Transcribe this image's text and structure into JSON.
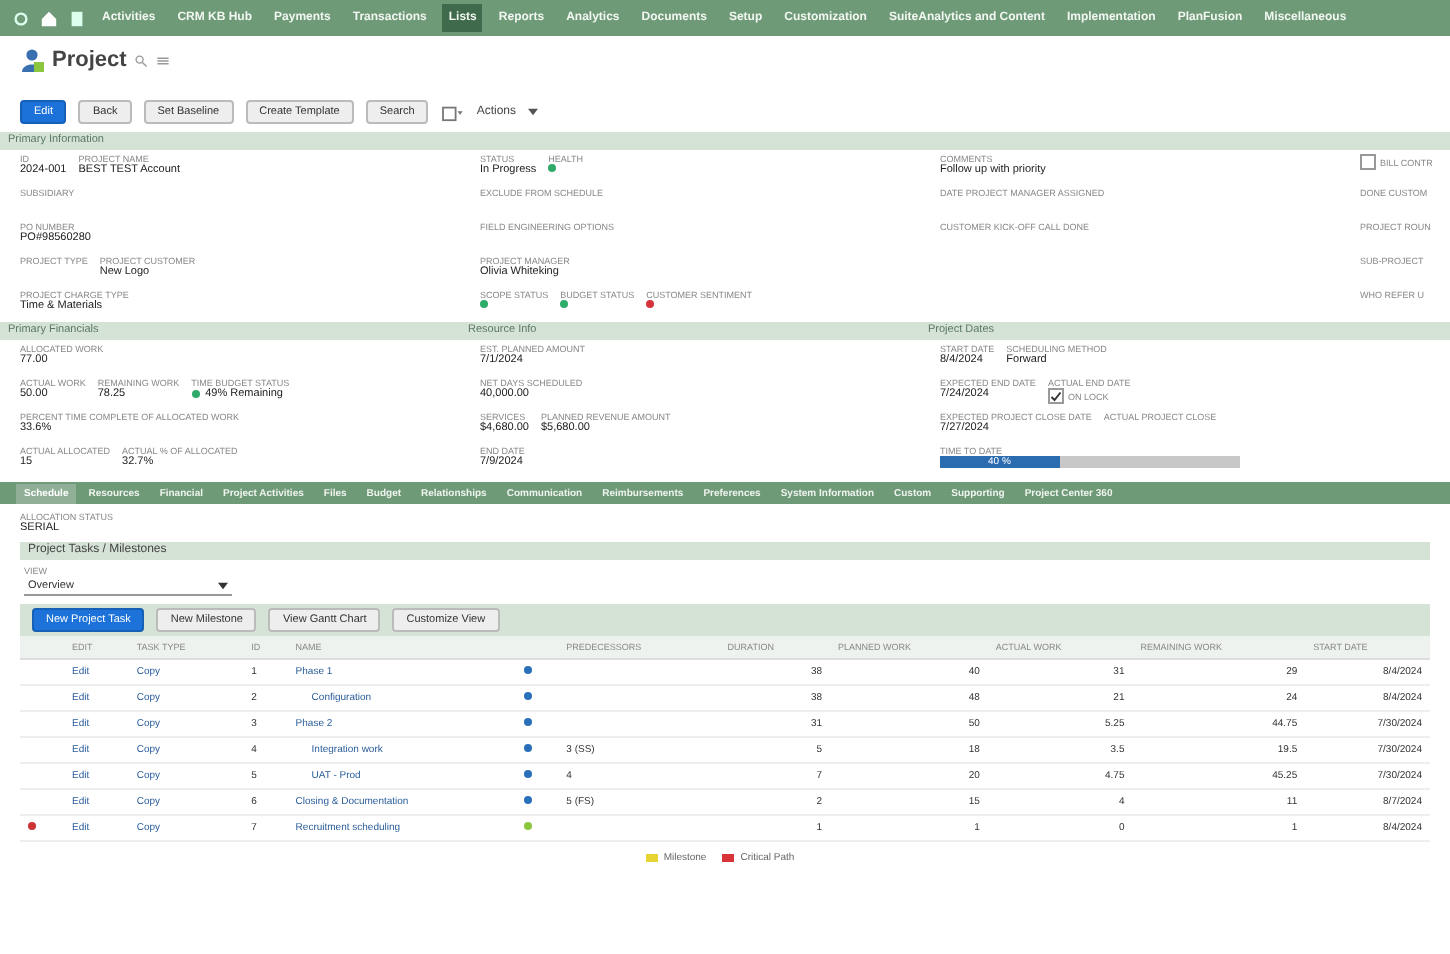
{
  "nav": {
    "items": [
      {
        "label": "Activities",
        "selected": false
      },
      {
        "label": "CRM KB Hub",
        "selected": false
      },
      {
        "label": "Payments",
        "selected": false
      },
      {
        "label": "Transactions",
        "selected": false
      },
      {
        "label": "Lists",
        "selected": true
      },
      {
        "label": "Reports",
        "selected": false
      },
      {
        "label": "Analytics",
        "selected": false
      },
      {
        "label": "Documents",
        "selected": false
      },
      {
        "label": "Setup",
        "selected": false
      },
      {
        "label": "Customization",
        "selected": false
      },
      {
        "label": "SuiteAnalytics and Content",
        "selected": false
      },
      {
        "label": "Implementation",
        "selected": false
      },
      {
        "label": "PlanFusion",
        "selected": false
      },
      {
        "label": "Miscellaneous",
        "selected": false
      }
    ]
  },
  "page": {
    "title": "Project"
  },
  "buttons": [
    {
      "label": "Edit",
      "primary": true
    },
    {
      "label": "Back",
      "primary": false
    },
    {
      "label": "Set Baseline",
      "primary": false
    },
    {
      "label": "Create Template",
      "primary": false
    },
    {
      "label": "Search",
      "primary": false
    }
  ],
  "actions": {
    "label": "Actions"
  },
  "primary_section": {
    "title": "Primary Information",
    "columns": [
      [
        [
          {
            "label": "ID",
            "value": "2024-001"
          },
          {
            "label": "PROJECT NAME",
            "value": "BEST TEST Account"
          }
        ],
        [
          {
            "label": "SUBSIDIARY"
          }
        ],
        [
          {
            "label": "PO NUMBER",
            "value": "PO#98560280"
          }
        ],
        [
          {
            "label": "PROJECT TYPE"
          },
          {
            "label": "PROJECT CUSTOMER",
            "value": "New Logo"
          }
        ],
        [
          {
            "label": "PROJECT CHARGE TYPE",
            "value": "Time & Materials"
          }
        ]
      ],
      [
        [
          {
            "label": "STATUS",
            "value": "In Progress"
          },
          {
            "label": "HEALTH",
            "color": "#2eaa6a"
          }
        ],
        [
          {
            "label": "EXCLUDE FROM SCHEDULE"
          }
        ],
        [
          {
            "label": "FIELD ENGINEERING OPTIONS"
          }
        ],
        [
          {
            "label": "PROJECT MANAGER",
            "value": "Olivia Whiteking"
          }
        ],
        [
          {
            "label": "SCOPE STATUS",
            "color": "#2eaa6a"
          },
          {
            "label": "BUDGET STATUS",
            "color": "#2eaa6a"
          },
          {
            "label": "CUSTOMER SENTIMENT",
            "color": "#d6333a"
          }
        ]
      ],
      [
        [
          {
            "label": "COMMENTS",
            "value": "Follow up with priority"
          }
        ],
        [
          {
            "label": "DATE PROJECT MANAGER ASSIGNED"
          }
        ],
        [
          {
            "label": "CUSTOMER KICK-OFF CALL DONE"
          }
        ]
      ],
      [
        [
          {
            "label": "BILL CONTR",
            "check": false
          }
        ],
        [
          {
            "label": "DONE CUSTOM"
          }
        ],
        [
          {
            "label": "PROJECT ROUN"
          }
        ],
        [
          {
            "label": "SUB-PROJECT"
          }
        ],
        [
          {
            "label": "WHO REFER U"
          }
        ]
      ]
    ]
  },
  "detail_sections": [
    {
      "title": "Primary Financials",
      "rows": [
        [
          {
            "label": "ALLOCATED WORK",
            "value": "77.00"
          }
        ],
        [
          {
            "label": "ACTUAL WORK",
            "value": "50.00"
          },
          {
            "label": "REMAINING WORK",
            "value": "78.25"
          },
          {
            "label": "TIME BUDGET STATUS",
            "color": "#2eaa6a",
            "value": "49% Remaining"
          }
        ],
        [
          {
            "label": "PERCENT TIME COMPLETE OF ALLOCATED WORK",
            "value": "33.6%"
          }
        ],
        [
          {
            "label": "ACTUAL ALLOCATED",
            "value": "15"
          },
          {
            "label": "ACTUAL % OF ALLOCATED",
            "value": "32.7%"
          }
        ]
      ]
    },
    {
      "title": "Resource Info",
      "rows": [
        [
          {
            "label": "EST. PLANNED AMOUNT",
            "value": "7/1/2024"
          }
        ],
        [
          {
            "label": "NET DAYS SCHEDULED",
            "value": "40,000.00"
          }
        ],
        [
          {
            "label": "SERVICES",
            "value": "$4,680.00"
          },
          {
            "label": "PLANNED REVENUE AMOUNT",
            "value": "$5,680.00"
          }
        ],
        [
          {
            "label": "END DATE",
            "value": "7/9/2024"
          }
        ]
      ]
    },
    {
      "title": "Project Dates",
      "rows": [
        [
          {
            "label": "START DATE",
            "value": "8/4/2024"
          },
          {
            "label": "SCHEDULING METHOD",
            "value": "Forward"
          }
        ],
        [
          {
            "label": "EXPECTED END DATE",
            "value": "7/24/2024"
          },
          {
            "label": "ACTUAL END DATE",
            "check": true,
            "check_label": "ON LOCK"
          }
        ],
        [
          {
            "label": "EXPECTED PROJECT CLOSE DATE",
            "value": "7/27/2024"
          },
          {
            "label": "ACTUAL PROJECT CLOSE"
          }
        ],
        [
          {
            "label": "TIME TO DATE",
            "level": 0.4,
            "value": "40 %"
          }
        ]
      ]
    }
  ],
  "subtabs": [
    {
      "label": "Schedule",
      "selected": true
    },
    {
      "label": "Resources",
      "selected": false
    },
    {
      "label": "Financial",
      "selected": false
    },
    {
      "label": "Project Activities",
      "selected": false
    },
    {
      "label": "Files",
      "selected": false
    },
    {
      "label": "Budget",
      "selected": false
    },
    {
      "label": "Relationships",
      "selected": false
    },
    {
      "label": "Communication",
      "selected": false
    },
    {
      "label": "Reimbursements",
      "selected": false
    },
    {
      "label": "Preferences",
      "selected": false
    },
    {
      "label": "System Information",
      "selected": false
    },
    {
      "label": "Custom",
      "selected": false
    },
    {
      "label": "Supporting",
      "selected": false
    },
    {
      "label": "Project Center 360",
      "selected": false
    }
  ],
  "schedule": {
    "field": {
      "label": "ALLOCATION STATUS",
      "value": "SERIAL"
    },
    "tasks_title": "Project Tasks / Milestones",
    "view": {
      "label": "VIEW",
      "value": "Overview"
    },
    "buttons": [
      {
        "label": "New Project Task",
        "primary": true
      },
      {
        "label": "New Milestone",
        "primary": false
      },
      {
        "label": "View Gantt Chart",
        "primary": false
      },
      {
        "label": "Customize View",
        "primary": false
      }
    ],
    "columns": [
      "EDIT",
      "TASK TYPE",
      "ID",
      "NAME",
      "",
      "PREDECESSORS",
      "DURATION",
      "PLANNED WORK",
      "ACTUAL WORK",
      "REMAINING WORK",
      "START DATE"
    ],
    "rows": [
      {
        "flag": false,
        "edit": "Edit",
        "type": "Copy",
        "id": "1",
        "name": "Phase 1",
        "indent": false,
        "color": "#2a6fb8",
        "pred": "",
        "dur": "38",
        "planned": "40",
        "actual": "31",
        "remaining": "29",
        "start": "8/4/2024"
      },
      {
        "flag": false,
        "edit": "Edit",
        "type": "Copy",
        "id": "2",
        "name": "Configuration",
        "indent": true,
        "color": "#2a6fb8",
        "pred": "",
        "dur": "38",
        "planned": "48",
        "actual": "21",
        "remaining": "24",
        "start": "8/4/2024"
      },
      {
        "flag": false,
        "edit": "Edit",
        "type": "Copy",
        "id": "3",
        "name": "Phase 2",
        "indent": false,
        "color": "#2a6fb8",
        "pred": "",
        "dur": "31",
        "planned": "50",
        "actual": "5.25",
        "remaining": "44.75",
        "start": "7/30/2024"
      },
      {
        "flag": false,
        "edit": "Edit",
        "type": "Copy",
        "id": "4",
        "name": "Integration work",
        "indent": true,
        "color": "#2a6fb8",
        "pred": "3 (SS)",
        "dur": "5",
        "planned": "18",
        "actual": "3.5",
        "remaining": "19.5",
        "start": "7/30/2024"
      },
      {
        "flag": false,
        "edit": "Edit",
        "type": "Copy",
        "id": "5",
        "name": "UAT - Prod",
        "indent": true,
        "color": "#2a6fb8",
        "pred": "4",
        "dur": "7",
        "planned": "20",
        "actual": "4.75",
        "remaining": "45.25",
        "start": "7/30/2024"
      },
      {
        "flag": false,
        "edit": "Edit",
        "type": "Copy",
        "id": "6",
        "name": "Closing & Documentation",
        "indent": false,
        "color": "#2a6fb8",
        "pred": "5 (FS)",
        "dur": "2",
        "planned": "15",
        "actual": "4",
        "remaining": "11",
        "start": "8/7/2024"
      },
      {
        "flag": true,
        "edit": "Edit",
        "type": "Copy",
        "id": "7",
        "name": "Recruitment scheduling",
        "indent": false,
        "color": "#8cc63f",
        "pred": "",
        "dur": "1",
        "planned": "1",
        "actual": "0",
        "remaining": "1",
        "start": "8/4/2024"
      }
    ],
    "legend": [
      {
        "label": "Milestone",
        "color": "#e8d432"
      },
      {
        "label": "Critical Path",
        "color": "#d6333a"
      }
    ]
  }
}
